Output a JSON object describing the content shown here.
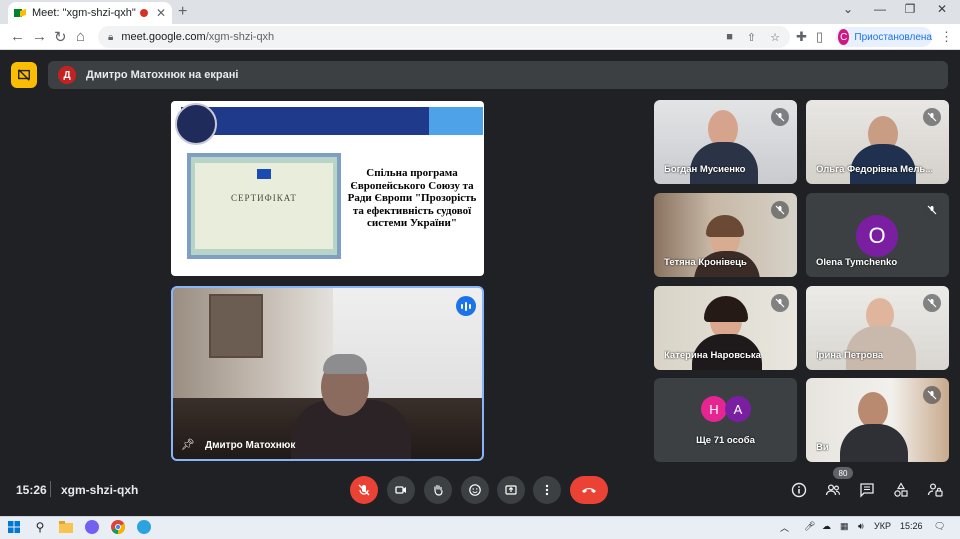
{
  "browser": {
    "tab_title": "Meet: \"xgm-shzi-qxh\"",
    "url_host": "meet.google.com",
    "url_path": "/xgm-shzi-qxh",
    "profile_initial": "C",
    "profile_label": "Приостановлена"
  },
  "banner": {
    "avatar_initial": "Д",
    "text": "Дмитро Матохнюк на екрані"
  },
  "slide": {
    "certificate_title": "СЕРТИФІКАТ",
    "caption": "Спільна програма Європейського Союзу та Ради Європи \"Прозорість та ефективність судової системи України\""
  },
  "presenter": {
    "name": "Дмитро Матохнюк"
  },
  "participants": [
    {
      "name": "Богдан Мусиенко"
    },
    {
      "name": "Ольга Федорівна Мель..."
    },
    {
      "name": "Тетяна Кронівець"
    },
    {
      "name": "Olena Tymchenko",
      "initial": "O"
    },
    {
      "name": "Катерина Наровська"
    },
    {
      "name": "Ірина Петрова"
    },
    {
      "name": "Ще 71 особа",
      "initials": [
        "H",
        "A"
      ]
    },
    {
      "name": "Ви"
    }
  ],
  "controls": {
    "time": "15:26",
    "meeting_code": "xgm-shzi-qxh",
    "people_count": "80"
  },
  "taskbar": {
    "lang": "УКР",
    "time": "15:26"
  },
  "colors": {
    "meet_bg": "#202124",
    "tile_bg": "#3c4043",
    "accent_blue": "#1a73e8",
    "end_call_red": "#ea4335",
    "present_yellow": "#fbbc04",
    "avatar_purple": "#7b1fa2",
    "avatar_pink": "#e52592"
  }
}
